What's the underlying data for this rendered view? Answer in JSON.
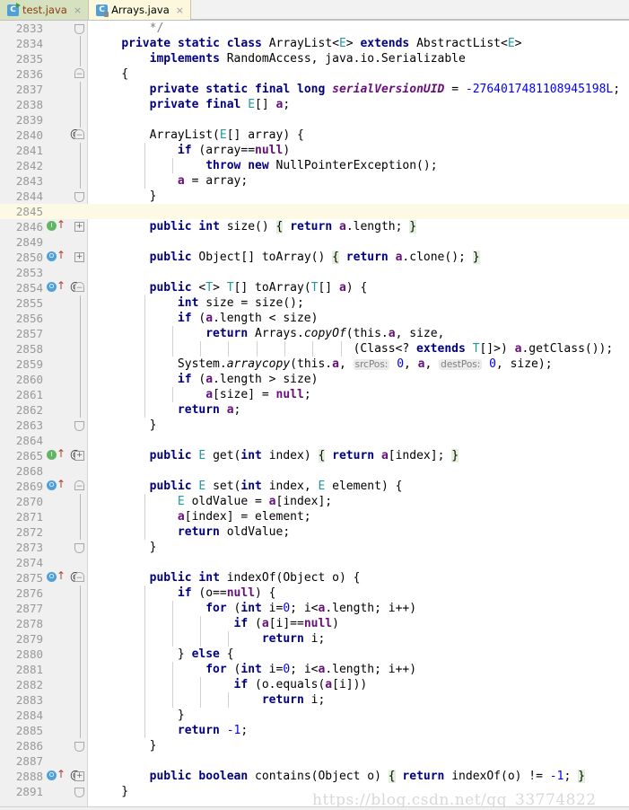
{
  "window": {
    "app": "IntelliJ IDEA Editor",
    "watermark": "https://blog.csdn.net/qq_33774822"
  },
  "tabs": [
    {
      "label": "test.java",
      "icon": "java-class-icon",
      "close": "×",
      "badge": "C",
      "active": false
    },
    {
      "label": "Arrays.java",
      "icon": "java-class-lock-icon",
      "close": "×",
      "badge": "C",
      "active": true
    }
  ],
  "editor": {
    "caret_line": 2845,
    "lines": [
      {
        "n": "2833",
        "fold": "cap-up",
        "run": "",
        "at": false
      },
      {
        "n": "2834",
        "fold": "line",
        "run": "",
        "at": false
      },
      {
        "n": "2835",
        "fold": "line",
        "run": "",
        "at": false
      },
      {
        "n": "2836",
        "fold": "cap",
        "run": "",
        "at": false
      },
      {
        "n": "2837",
        "fold": "line",
        "run": "",
        "at": false
      },
      {
        "n": "2838",
        "fold": "line",
        "run": "",
        "at": false
      },
      {
        "n": "2839",
        "fold": "line",
        "run": "",
        "at": false
      },
      {
        "n": "2840",
        "fold": "cap",
        "run": "",
        "at": true
      },
      {
        "n": "2841",
        "fold": "line",
        "run": "",
        "at": false
      },
      {
        "n": "2842",
        "fold": "line",
        "run": "",
        "at": false
      },
      {
        "n": "2843",
        "fold": "line",
        "run": "",
        "at": false
      },
      {
        "n": "2844",
        "fold": "cap-up",
        "run": "",
        "at": false
      },
      {
        "n": "2845",
        "fold": "",
        "run": "",
        "at": false
      },
      {
        "n": "2846",
        "fold": "plus",
        "run": "g",
        "at": false
      },
      {
        "n": "2849",
        "fold": "",
        "run": "",
        "at": false
      },
      {
        "n": "2850",
        "fold": "plus",
        "run": "b",
        "at": false
      },
      {
        "n": "2853",
        "fold": "",
        "run": "",
        "at": false
      },
      {
        "n": "2854",
        "fold": "cap",
        "run": "b",
        "at": true
      },
      {
        "n": "2855",
        "fold": "line",
        "run": "",
        "at": false
      },
      {
        "n": "2856",
        "fold": "line",
        "run": "",
        "at": false
      },
      {
        "n": "2857",
        "fold": "line",
        "run": "",
        "at": false
      },
      {
        "n": "2858",
        "fold": "line",
        "run": "",
        "at": false
      },
      {
        "n": "2859",
        "fold": "line",
        "run": "",
        "at": false
      },
      {
        "n": "2860",
        "fold": "line",
        "run": "",
        "at": false
      },
      {
        "n": "2861",
        "fold": "line",
        "run": "",
        "at": false
      },
      {
        "n": "2862",
        "fold": "line",
        "run": "",
        "at": false
      },
      {
        "n": "2863",
        "fold": "cap-up",
        "run": "",
        "at": false
      },
      {
        "n": "2864",
        "fold": "",
        "run": "",
        "at": false
      },
      {
        "n": "2865",
        "fold": "plus",
        "run": "g",
        "at": true
      },
      {
        "n": "2868",
        "fold": "",
        "run": "",
        "at": false
      },
      {
        "n": "2869",
        "fold": "cap",
        "run": "b",
        "at": false
      },
      {
        "n": "2870",
        "fold": "line",
        "run": "",
        "at": false
      },
      {
        "n": "2871",
        "fold": "line",
        "run": "",
        "at": false
      },
      {
        "n": "2872",
        "fold": "line",
        "run": "",
        "at": false
      },
      {
        "n": "2873",
        "fold": "cap-up",
        "run": "",
        "at": false
      },
      {
        "n": "2874",
        "fold": "",
        "run": "",
        "at": false
      },
      {
        "n": "2875",
        "fold": "cap",
        "run": "b",
        "at": true
      },
      {
        "n": "2876",
        "fold": "line",
        "run": "",
        "at": false
      },
      {
        "n": "2877",
        "fold": "line",
        "run": "",
        "at": false
      },
      {
        "n": "2878",
        "fold": "line",
        "run": "",
        "at": false
      },
      {
        "n": "2879",
        "fold": "line",
        "run": "",
        "at": false
      },
      {
        "n": "2880",
        "fold": "line",
        "run": "",
        "at": false
      },
      {
        "n": "2881",
        "fold": "line",
        "run": "",
        "at": false
      },
      {
        "n": "2882",
        "fold": "line",
        "run": "",
        "at": false
      },
      {
        "n": "2883",
        "fold": "line",
        "run": "",
        "at": false
      },
      {
        "n": "2884",
        "fold": "line",
        "run": "",
        "at": false
      },
      {
        "n": "2885",
        "fold": "line",
        "run": "",
        "at": false
      },
      {
        "n": "2886",
        "fold": "cap-up",
        "run": "",
        "at": false
      },
      {
        "n": "2887",
        "fold": "",
        "run": "",
        "at": false
      },
      {
        "n": "2888",
        "fold": "plus",
        "run": "b",
        "at": true
      },
      {
        "n": "2891",
        "fold": "cap-up",
        "run": "",
        "at": false
      }
    ],
    "code_text": [
      "        */",
      "    private static class ArrayList<E> extends AbstractList<E>",
      "        implements RandomAccess, java.io.Serializable",
      "    {",
      "        private static final long serialVersionUID = -2764017481108945198L;",
      "        private final E[] a;",
      "",
      "        ArrayList(E[] array) {",
      "            if (array==null)",
      "                throw new NullPointerException();",
      "            a = array;",
      "        }",
      "",
      "        public int size() { return a.length; }",
      "",
      "        public Object[] toArray() { return a.clone(); }",
      "",
      "        public <T> T[] toArray(T[] a) {",
      "            int size = size();",
      "            if (a.length < size)",
      "                return Arrays.copyOf(this.a, size,",
      "                                     (Class<? extends T[]>) a.getClass());",
      "            System.arraycopy(this.a,  srcPos: 0, a,  destPos: 0, size);",
      "            if (a.length > size)",
      "                a[size] = null;",
      "            return a;",
      "        }",
      "",
      "        public E get(int index) { return a[index]; }",
      "",
      "        public E set(int index, E element) {",
      "            E oldValue = a[index];",
      "            a[index] = element;",
      "            return oldValue;",
      "        }",
      "",
      "        public int indexOf(Object o) {",
      "            if (o==null) {",
      "                for (int i=0; i<a.length; i++)",
      "                    if (a[i]==null)",
      "                        return i;",
      "            } else {",
      "                for (int i=0; i<a.length; i++)",
      "                    if (o.equals(a[i]))",
      "                        return i;",
      "            }",
      "            return -1;",
      "        }",
      "",
      "        public boolean contains(Object o) { return indexOf(o) != -1; }",
      "    }"
    ]
  },
  "colors": {
    "keyword": "#000080",
    "type": "#20999d",
    "field": "#660e7a",
    "number": "#0000ff",
    "comment": "#808080",
    "caret_line_bg": "#fcf9e4",
    "brace_match_bg": "#e3f0dc",
    "gutter_bg": "#f0f0f0",
    "tab_active_bg": "#fbf8dd",
    "tab_inactive_bg": "#d6e2bf"
  }
}
